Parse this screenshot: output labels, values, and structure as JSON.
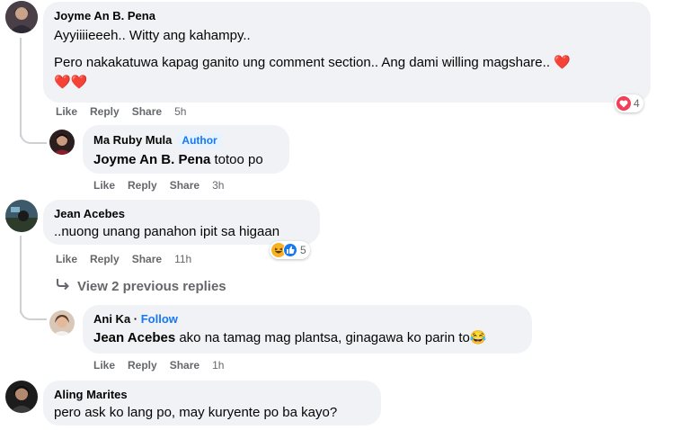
{
  "colors": {
    "bubble": "#f0f2f5",
    "link": "#1877f2",
    "meta": "#65676b",
    "heart": "#f33e58",
    "like": "#1877f2",
    "haha": "#f7b125"
  },
  "actions": {
    "like": "Like",
    "reply": "Reply",
    "share": "Share"
  },
  "comments": [
    {
      "author": "Joyme An B. Pena",
      "line1": "Ayyiiiieeeh.. Witty ang kahampy..",
      "line2": "Pero nakakatuwa kapag ganito ung comment section.. Ang dami willing magshare..",
      "time": "5h",
      "reactions": {
        "icon": "heart-icon",
        "count": "4"
      }
    },
    {
      "author": "Ma Ruby Mula",
      "badge": "Author",
      "mention": "Joyme An B. Pena",
      "text": " totoo po",
      "time": "3h"
    },
    {
      "author": "Jean Acebes",
      "text": "..nuong unang panahon ipit sa higaan",
      "time": "11h",
      "reactions": {
        "icons": [
          "haha-icon",
          "like-icon"
        ],
        "count": "5"
      }
    },
    {
      "author": "Ani Ka",
      "separator": " · ",
      "follow": "Follow",
      "mention": "Jean Acebes",
      "text": " ako na tamag mag plantsa, ginagawa ko parin to",
      "time": "1h"
    },
    {
      "author": "Aling Marites",
      "text": "pero ask ko lang po, may kuryente po ba kayo?"
    }
  ],
  "view_replies": {
    "icon": "reply-arrow-icon",
    "label": "View 2 previous replies"
  }
}
